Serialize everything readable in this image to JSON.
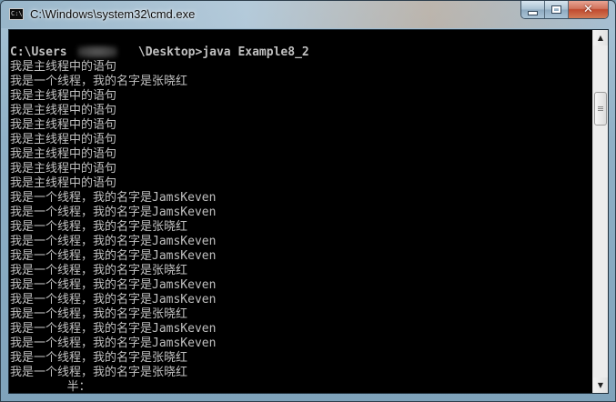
{
  "window": {
    "title": "C:\\Windows\\system32\\cmd.exe",
    "icon": "cmd-icon",
    "controls": {
      "minimize": "minimize-icon",
      "maximize": "maximize-icon",
      "close": "close-icon",
      "close_glyph": "✕"
    }
  },
  "console": {
    "lines": [
      "C:\\Users          \\Desktop>java Example8_2",
      "我是主线程中的语句",
      "我是一个线程，我的名字是张晓红",
      "我是主线程中的语句",
      "我是主线程中的语句",
      "我是主线程中的语句",
      "我是主线程中的语句",
      "我是主线程中的语句",
      "我是主线程中的语句",
      "我是主线程中的语句",
      "我是一个线程，我的名字是JamsKeven",
      "我是一个线程，我的名字是JamsKeven",
      "我是一个线程，我的名字是张晓红",
      "我是一个线程，我的名字是JamsKeven",
      "我是一个线程，我的名字是JamsKeven",
      "我是一个线程，我的名字是张晓红",
      "我是一个线程，我的名字是JamsKeven",
      "我是一个线程，我的名字是JamsKeven",
      "我是一个线程，我的名字是张晓红",
      "我是一个线程，我的名字是JamsKeven",
      "我是一个线程，我的名字是JamsKeven",
      "我是一个线程，我的名字是张晓红",
      "我是一个线程，我的名字是张晓红",
      "        半："
    ]
  },
  "scrollbar": {
    "up_arrow": "▲",
    "down_arrow": "▼"
  },
  "colors": {
    "console_bg": "#000000",
    "console_text": "#c0c0c0",
    "close_button": "#c8533a"
  }
}
